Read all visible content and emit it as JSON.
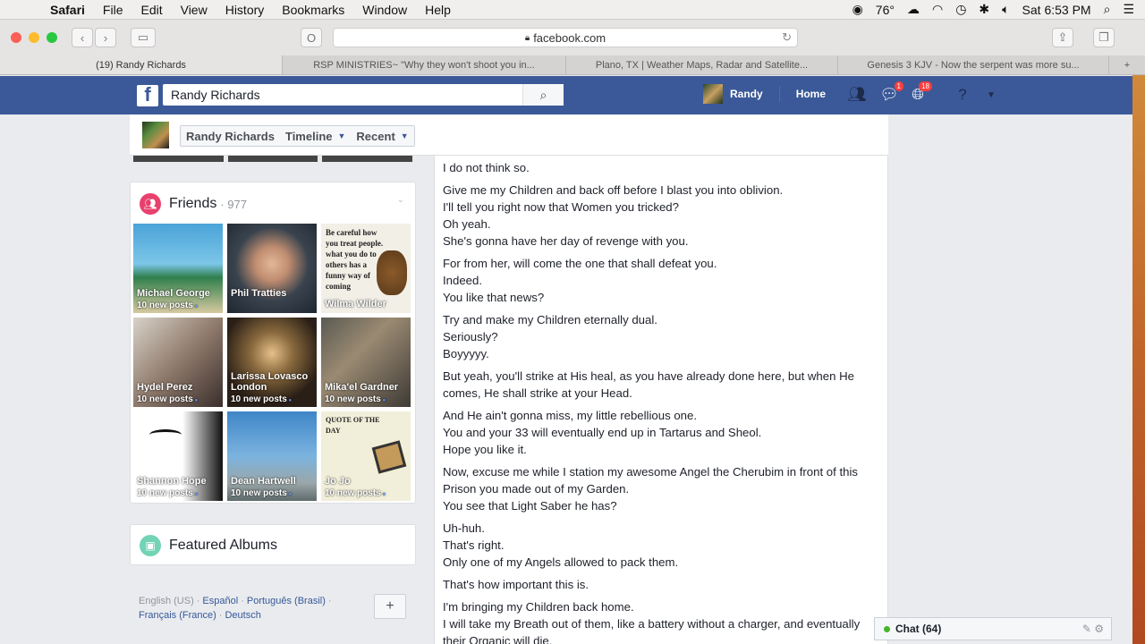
{
  "menubar": {
    "app": "Safari",
    "items": [
      "File",
      "Edit",
      "View",
      "History",
      "Bookmarks",
      "Window",
      "Help"
    ],
    "temperature": "76°",
    "datetime": "Sat 6:53 PM"
  },
  "toolbar": {
    "url": "facebook.com"
  },
  "tabs": [
    "(19) Randy Richards",
    "RSP MINISTRIES~ \"Why they won't shoot you in...",
    "Plano, TX | Weather Maps, Radar and Satellite...",
    "Genesis 3 KJV - Now the serpent was more su..."
  ],
  "fb": {
    "search_value": "Randy Richards",
    "user_name": "Randy",
    "home": "Home",
    "messages_badge": "1",
    "notifications_badge": "18"
  },
  "profile": {
    "name": "Randy Richards",
    "timeline": "Timeline",
    "recent": "Recent"
  },
  "friends": {
    "title": "Friends",
    "count": "· 977",
    "items": [
      {
        "name": "Michael George",
        "posts": "10 new posts"
      },
      {
        "name": "Phil Tratties",
        "posts": ""
      },
      {
        "name": "Wilma Wilder",
        "posts": "",
        "caption": "Be careful how you treat people. what you do to others has a funny way of coming"
      },
      {
        "name": "Hydel Perez",
        "posts": "10 new posts"
      },
      {
        "name": "Larissa Lovasco London",
        "posts": "10 new posts"
      },
      {
        "name": "Mika'el Gardner",
        "posts": "10 new posts"
      },
      {
        "name": "Shannon Hope",
        "posts": "10 new posts"
      },
      {
        "name": "Dean Hartwell",
        "posts": "10 new posts"
      },
      {
        "name": "Jo Jo",
        "posts": "10 new posts",
        "caption": "QUOTE OF THE DAY"
      }
    ]
  },
  "featured": {
    "title": "Featured Albums"
  },
  "languages": {
    "current": "English (US)",
    "links": [
      "Español",
      "Português (Brasil)",
      "Français (France)",
      "Deutsch"
    ],
    "add": "+"
  },
  "post": {
    "paragraphs": [
      "I do not think so.",
      "Give me my Children and back off before I blast you into oblivion.\nI'll tell you right now that Women you tricked?\nOh yeah.\nShe's gonna have her day of revenge with you.",
      "For from her, will come the one that shall defeat you.\nIndeed.\nYou like that news?",
      "Try and make my Children eternally dual.\nSeriously?\nBoyyyyy.",
      "But yeah, you'll strike at His heal, as you have already done here, but when He comes, He shall strike at your Head.",
      "And He ain't gonna miss, my little rebellious one.\nYou and your 33 will eventually end up in Tartarus and Sheol.\nHope you like it.",
      "Now, excuse me while I station my awesome Angel the Cherubim in front of this Prison you made out of my Garden.\nYou see that Light Saber he has?",
      "Uh-huh.\nThat's right.\nOnly one of my Angels allowed to pack them.",
      "That's how important this is.",
      "I'm bringing my Children back home.\nI will take my Breath out of them, like a battery without a charger, and eventually their Organic will die."
    ]
  },
  "chat": {
    "label": "Chat (64)"
  }
}
